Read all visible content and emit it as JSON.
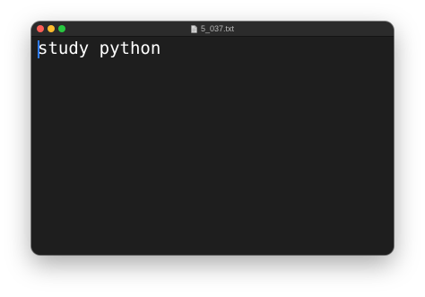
{
  "window": {
    "title": "5_037.txt",
    "icon": "document-icon"
  },
  "editor": {
    "content": "study python"
  },
  "colors": {
    "close": "#fe5f57",
    "minimize": "#febc2e",
    "zoom": "#28c840",
    "background": "#1e1e1e",
    "text": "#ffffff",
    "caret": "#2f7cf6"
  }
}
